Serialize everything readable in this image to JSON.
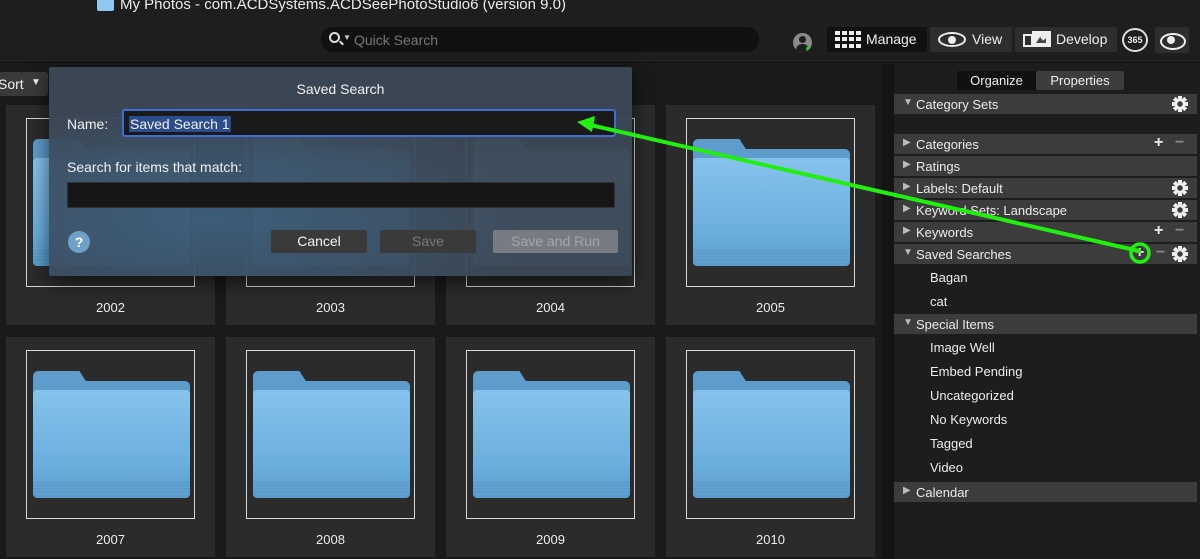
{
  "window": {
    "title": "My Photos - com.ACDSystems.ACDSeePhotoStudio6 (version 9.0)"
  },
  "toolbar": {
    "search_placeholder": "Quick Search",
    "modes": {
      "manage": "Manage",
      "view": "View",
      "develop": "Develop"
    },
    "badge_365": "365"
  },
  "browser": {
    "sort_label": "Sort",
    "folders": [
      "2002",
      "2003",
      "2004",
      "2005",
      "2007",
      "2008",
      "2009",
      "2010"
    ]
  },
  "dialog": {
    "title": "Saved Search",
    "name_label": "Name:",
    "name_value": "Saved Search 1",
    "match_label": "Search for items that match:",
    "help": "?",
    "cancel": "Cancel",
    "save": "Save",
    "save_and_run": "Save and Run"
  },
  "panel": {
    "tabs": {
      "organize": "Organize",
      "properties": "Properties"
    },
    "sections": {
      "category_sets": "Category Sets",
      "categories": "Categories",
      "ratings": "Ratings",
      "labels": "Labels: Default",
      "keyword_sets": "Keyword Sets: Landscape",
      "keywords": "Keywords",
      "saved_searches": "Saved Searches",
      "special_items": "Special Items",
      "calendar": "Calendar"
    },
    "saved_searches": [
      "Bagan",
      "cat"
    ],
    "special_items": [
      "Image Well",
      "Embed Pending",
      "Uncategorized",
      "No Keywords",
      "Tagged",
      "Video"
    ],
    "plus": "+",
    "minus": "−"
  },
  "colors": {
    "annotation": "#22ee11",
    "selection": "#3f6ed0",
    "folder": "#6aaedd"
  }
}
